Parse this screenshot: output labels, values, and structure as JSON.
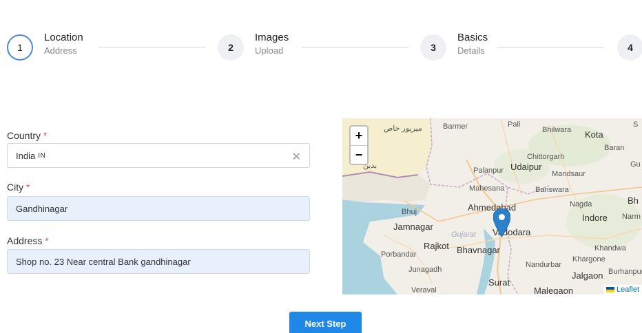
{
  "stepper": {
    "steps": [
      {
        "number": "1",
        "title": "Location",
        "subtitle": "Address",
        "active": true
      },
      {
        "number": "2",
        "title": "Images",
        "subtitle": "Upload",
        "active": false
      },
      {
        "number": "3",
        "title": "Basics",
        "subtitle": "Details",
        "active": false
      },
      {
        "number": "4",
        "title": "",
        "subtitle": "",
        "active": false
      }
    ]
  },
  "form": {
    "country": {
      "label": "Country",
      "required_mark": "*",
      "value": "India",
      "code": "IN",
      "clear_icon": "close-icon"
    },
    "city": {
      "label": "City",
      "required_mark": "*",
      "value": "Gandhinagar"
    },
    "address": {
      "label": "Address",
      "required_mark": "*",
      "value": "Shop no. 23 Near central Bank  gandhinagar"
    }
  },
  "map": {
    "zoom_in": "+",
    "zoom_out": "−",
    "attribution": "Leaflet",
    "labels": {
      "mirpur_khas": "میرپور خاص",
      "badin": "بدین",
      "barmer": "Barmer",
      "pali": "Pali",
      "bhilwara": "Bhilwara",
      "kota": "Kota",
      "baran": "Baran",
      "chittorgarh": "Chittorgarh",
      "gu": "Gu",
      "palanpur": "Palanpur",
      "udaipur": "Udaipur",
      "mandsaur": "Mandsaur",
      "mahesana": "Mahesana",
      "banswara": "Banswara",
      "bh": "Bh",
      "bhuj": "Bhuj",
      "ahmedabad": "Ahmedabad",
      "nagda": "Nagda",
      "indore": "Indore",
      "narm": "Narm",
      "jamnagar": "Jamnagar",
      "gujarat": "Gujarat",
      "vadodara": "Vadodara",
      "rajkot": "Rajkot",
      "bhavnagar": "Bhavnagar",
      "khandwa": "Khandwa",
      "porbandar": "Porbandar",
      "khargone": "Khargone",
      "nandurbar": "Nandurbar",
      "junagadh": "Junagadh",
      "burhanpur": "Burhanpur",
      "jalgaon": "Jalgaon",
      "surat": "Surat",
      "veraval": "Veraval",
      "malegaon": "Malegaon",
      "s": "S"
    }
  },
  "actions": {
    "next_label": "Next Step"
  },
  "colors": {
    "primary": "#1f87e5",
    "active_ring": "#4b8ad6",
    "required": "#e05a5a",
    "filled_bg": "#e8f0fc"
  }
}
